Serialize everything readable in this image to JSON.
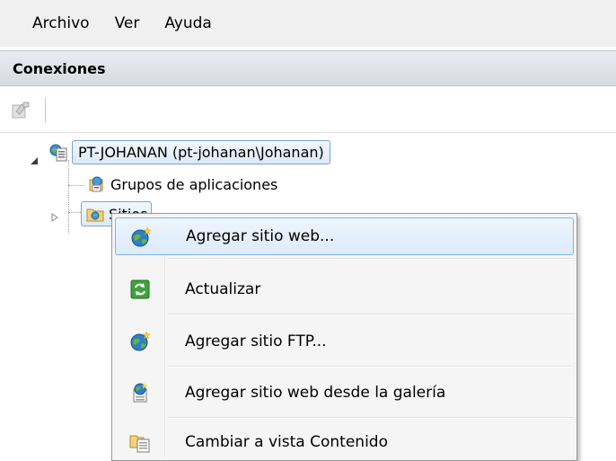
{
  "menubar": {
    "items": [
      "Archivo",
      "Ver",
      "Ayuda"
    ]
  },
  "panel": {
    "title": "Conexiones"
  },
  "tree": {
    "server_label": "PT-JOHANAN (pt-johanan\\Johanan)",
    "app_pools_label": "Grupos de aplicaciones",
    "sites_label": "Sitios"
  },
  "context_menu": {
    "items": [
      {
        "label": "Agregar sitio web...",
        "icon": "globe-star-icon",
        "highlighted": true
      },
      {
        "label": "Actualizar",
        "icon": "refresh-icon",
        "highlighted": false
      },
      {
        "label": "Agregar sitio FTP...",
        "icon": "globe-star-icon",
        "highlighted": false
      },
      {
        "label": "Agregar sitio web desde la galería",
        "icon": "gallery-globe-icon",
        "highlighted": false
      },
      {
        "label": "Cambiar a vista Contenido",
        "icon": "content-view-icon",
        "highlighted": false
      }
    ]
  },
  "colors": {
    "highlight_border": "#7eb4ea",
    "highlight_fill": "#dcebfc",
    "menu_background": "#f5f5f5",
    "header_background": "#dde2e7"
  }
}
